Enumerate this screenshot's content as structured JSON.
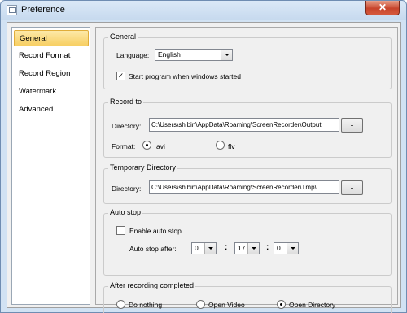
{
  "window": {
    "title": "Preference",
    "close_glyph": "✕"
  },
  "sidebar": {
    "items": [
      {
        "label": "General",
        "active": true
      },
      {
        "label": "Record Format",
        "active": false
      },
      {
        "label": "Record Region",
        "active": false
      },
      {
        "label": "Watermark",
        "active": false
      },
      {
        "label": "Advanced",
        "active": false
      }
    ]
  },
  "general": {
    "title": "General",
    "language_label": "Language:",
    "language_value": "English",
    "start_label": "Start program when windows started",
    "start_checked": true
  },
  "record_to": {
    "title": "Record to",
    "directory_label": "Directory:",
    "directory_value": "C:\\Users\\shibin\\AppData\\Roaming\\ScreenRecorder\\Output",
    "browse_label": "..",
    "format_label": "Format:",
    "format_options": [
      "avi",
      "flv"
    ],
    "format_selected": "avi"
  },
  "temp_dir": {
    "title": "Temporary Directory",
    "directory_label": "Directory:",
    "directory_value": "C:\\Users\\shibin\\AppData\\Roaming\\ScreenRecorder\\Tmp\\",
    "browse_label": ".."
  },
  "auto_stop": {
    "title": "Auto stop",
    "enable_label": "Enable auto stop",
    "enable_checked": false,
    "after_label": "Auto stop after:",
    "hours": "0",
    "minutes": "17",
    "seconds": "0",
    "separator": ":"
  },
  "after_recording": {
    "title": "After recording completed",
    "options": [
      "Do nothing",
      "Open Video",
      "Open Directory"
    ],
    "selected": "Open Directory"
  }
}
